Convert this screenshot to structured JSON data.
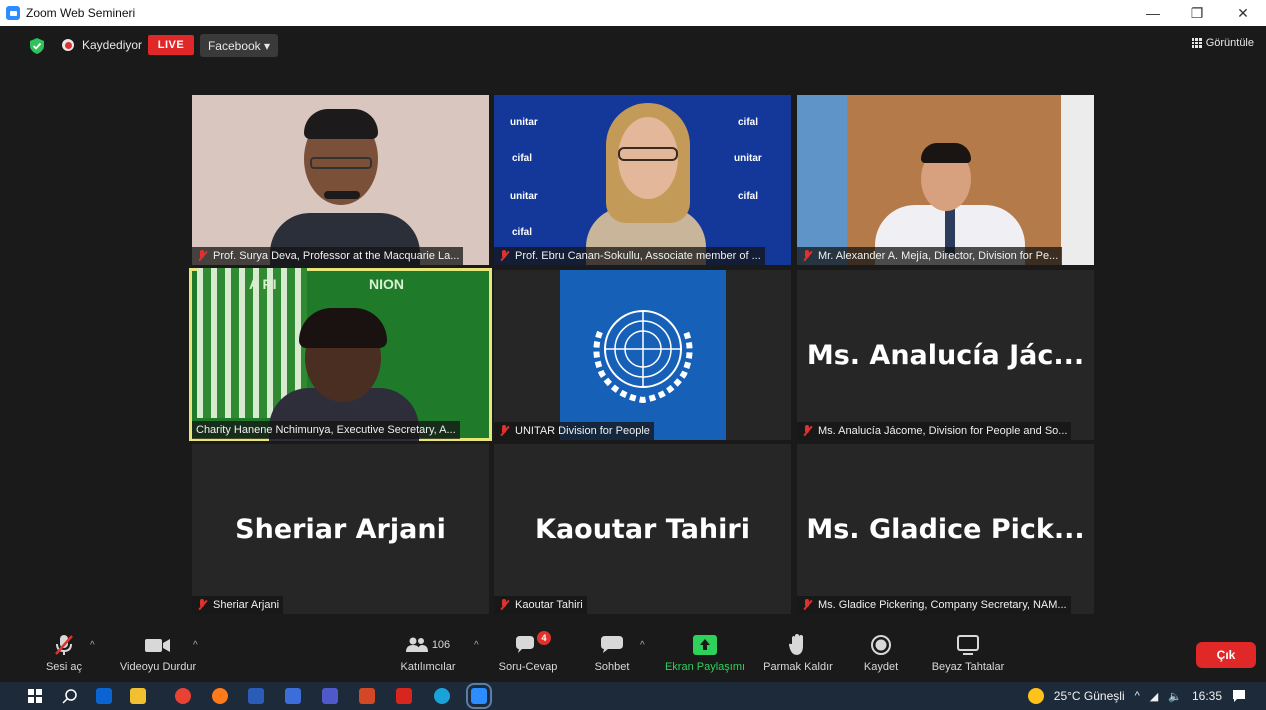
{
  "window": {
    "title": "Zoom Web Semineri",
    "minimize": "—",
    "restore": "❐",
    "close": "✕"
  },
  "topbar": {
    "recording_label": "Kaydediyor",
    "live_label": "LIVE",
    "stream_target": "Facebook ▾",
    "view_label": "Görüntüle"
  },
  "tiles": [
    {
      "caption": "Prof. Surya Deva, Professor at the Macquarie La..."
    },
    {
      "caption": "Prof. Ebru Canan-Sokullu, Associate member of ..."
    },
    {
      "caption": "Mr. Alexander A. Mejía, Director, Division for Pe..."
    },
    {
      "caption": "Charity Hanene Nchimunya, Executive Secretary, A..."
    },
    {
      "caption": "UNITAR Division for People"
    },
    {
      "big_name": "Ms. Analucía Jác...",
      "caption": "Ms. Analucía Jácome, Division for People and So..."
    },
    {
      "big_name": "Sheriar Arjani",
      "caption": "Sheriar Arjani"
    },
    {
      "big_name": "Kaoutar Tahiri",
      "caption": "Kaoutar Tahiri"
    },
    {
      "big_name": "Ms. Gladice Pick...",
      "caption": "Ms. Gladice Pickering, Company Secretary, NAM..."
    }
  ],
  "backdrop_logos": {
    "unitar": "unitar",
    "cifal": "cifal"
  },
  "green_banner": {
    "left": "A  RI",
    "right": "NION"
  },
  "toolbar": {
    "mute": "Sesi aç",
    "video": "Videoyu Durdur",
    "participants": "Katılımcılar",
    "participant_count": "106",
    "qa": "Soru-Cevap",
    "qa_badge": "4",
    "chat": "Sohbet",
    "share": "Ekran Paylaşımı",
    "raise_hand": "Parmak Kaldır",
    "record": "Kaydet",
    "whiteboard": "Beyaz Tahtalar",
    "leave": "Çık"
  },
  "taskbar": {
    "weather": "25°C  Güneşli",
    "time": "16:35"
  },
  "colors": {
    "live_red": "#e02828",
    "share_green": "#2ed15a",
    "speaker_outline": "#e6e67a",
    "zoom_blue": "#2d8cff"
  }
}
